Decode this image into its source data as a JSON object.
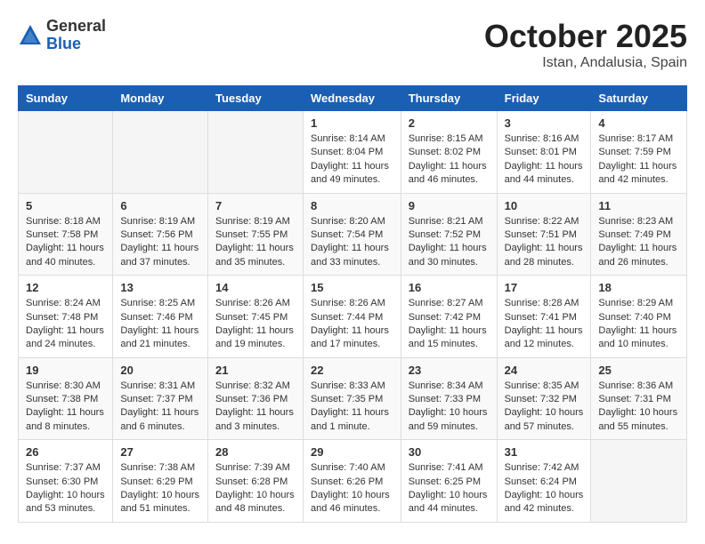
{
  "header": {
    "logo": {
      "general": "General",
      "blue": "Blue"
    },
    "title": "October 2025",
    "subtitle": "Istan, Andalusia, Spain"
  },
  "weekdays": [
    "Sunday",
    "Monday",
    "Tuesday",
    "Wednesday",
    "Thursday",
    "Friday",
    "Saturday"
  ],
  "weeks": [
    [
      {
        "day": "",
        "info": ""
      },
      {
        "day": "",
        "info": ""
      },
      {
        "day": "",
        "info": ""
      },
      {
        "day": "1",
        "info": "Sunrise: 8:14 AM\nSunset: 8:04 PM\nDaylight: 11 hours\nand 49 minutes."
      },
      {
        "day": "2",
        "info": "Sunrise: 8:15 AM\nSunset: 8:02 PM\nDaylight: 11 hours\nand 46 minutes."
      },
      {
        "day": "3",
        "info": "Sunrise: 8:16 AM\nSunset: 8:01 PM\nDaylight: 11 hours\nand 44 minutes."
      },
      {
        "day": "4",
        "info": "Sunrise: 8:17 AM\nSunset: 7:59 PM\nDaylight: 11 hours\nand 42 minutes."
      }
    ],
    [
      {
        "day": "5",
        "info": "Sunrise: 8:18 AM\nSunset: 7:58 PM\nDaylight: 11 hours\nand 40 minutes."
      },
      {
        "day": "6",
        "info": "Sunrise: 8:19 AM\nSunset: 7:56 PM\nDaylight: 11 hours\nand 37 minutes."
      },
      {
        "day": "7",
        "info": "Sunrise: 8:19 AM\nSunset: 7:55 PM\nDaylight: 11 hours\nand 35 minutes."
      },
      {
        "day": "8",
        "info": "Sunrise: 8:20 AM\nSunset: 7:54 PM\nDaylight: 11 hours\nand 33 minutes."
      },
      {
        "day": "9",
        "info": "Sunrise: 8:21 AM\nSunset: 7:52 PM\nDaylight: 11 hours\nand 30 minutes."
      },
      {
        "day": "10",
        "info": "Sunrise: 8:22 AM\nSunset: 7:51 PM\nDaylight: 11 hours\nand 28 minutes."
      },
      {
        "day": "11",
        "info": "Sunrise: 8:23 AM\nSunset: 7:49 PM\nDaylight: 11 hours\nand 26 minutes."
      }
    ],
    [
      {
        "day": "12",
        "info": "Sunrise: 8:24 AM\nSunset: 7:48 PM\nDaylight: 11 hours\nand 24 minutes."
      },
      {
        "day": "13",
        "info": "Sunrise: 8:25 AM\nSunset: 7:46 PM\nDaylight: 11 hours\nand 21 minutes."
      },
      {
        "day": "14",
        "info": "Sunrise: 8:26 AM\nSunset: 7:45 PM\nDaylight: 11 hours\nand 19 minutes."
      },
      {
        "day": "15",
        "info": "Sunrise: 8:26 AM\nSunset: 7:44 PM\nDaylight: 11 hours\nand 17 minutes."
      },
      {
        "day": "16",
        "info": "Sunrise: 8:27 AM\nSunset: 7:42 PM\nDaylight: 11 hours\nand 15 minutes."
      },
      {
        "day": "17",
        "info": "Sunrise: 8:28 AM\nSunset: 7:41 PM\nDaylight: 11 hours\nand 12 minutes."
      },
      {
        "day": "18",
        "info": "Sunrise: 8:29 AM\nSunset: 7:40 PM\nDaylight: 11 hours\nand 10 minutes."
      }
    ],
    [
      {
        "day": "19",
        "info": "Sunrise: 8:30 AM\nSunset: 7:38 PM\nDaylight: 11 hours\nand 8 minutes."
      },
      {
        "day": "20",
        "info": "Sunrise: 8:31 AM\nSunset: 7:37 PM\nDaylight: 11 hours\nand 6 minutes."
      },
      {
        "day": "21",
        "info": "Sunrise: 8:32 AM\nSunset: 7:36 PM\nDaylight: 11 hours\nand 3 minutes."
      },
      {
        "day": "22",
        "info": "Sunrise: 8:33 AM\nSunset: 7:35 PM\nDaylight: 11 hours\nand 1 minute."
      },
      {
        "day": "23",
        "info": "Sunrise: 8:34 AM\nSunset: 7:33 PM\nDaylight: 10 hours\nand 59 minutes."
      },
      {
        "day": "24",
        "info": "Sunrise: 8:35 AM\nSunset: 7:32 PM\nDaylight: 10 hours\nand 57 minutes."
      },
      {
        "day": "25",
        "info": "Sunrise: 8:36 AM\nSunset: 7:31 PM\nDaylight: 10 hours\nand 55 minutes."
      }
    ],
    [
      {
        "day": "26",
        "info": "Sunrise: 7:37 AM\nSunset: 6:30 PM\nDaylight: 10 hours\nand 53 minutes."
      },
      {
        "day": "27",
        "info": "Sunrise: 7:38 AM\nSunset: 6:29 PM\nDaylight: 10 hours\nand 51 minutes."
      },
      {
        "day": "28",
        "info": "Sunrise: 7:39 AM\nSunset: 6:28 PM\nDaylight: 10 hours\nand 48 minutes."
      },
      {
        "day": "29",
        "info": "Sunrise: 7:40 AM\nSunset: 6:26 PM\nDaylight: 10 hours\nand 46 minutes."
      },
      {
        "day": "30",
        "info": "Sunrise: 7:41 AM\nSunset: 6:25 PM\nDaylight: 10 hours\nand 44 minutes."
      },
      {
        "day": "31",
        "info": "Sunrise: 7:42 AM\nSunset: 6:24 PM\nDaylight: 10 hours\nand 42 minutes."
      },
      {
        "day": "",
        "info": ""
      }
    ]
  ]
}
